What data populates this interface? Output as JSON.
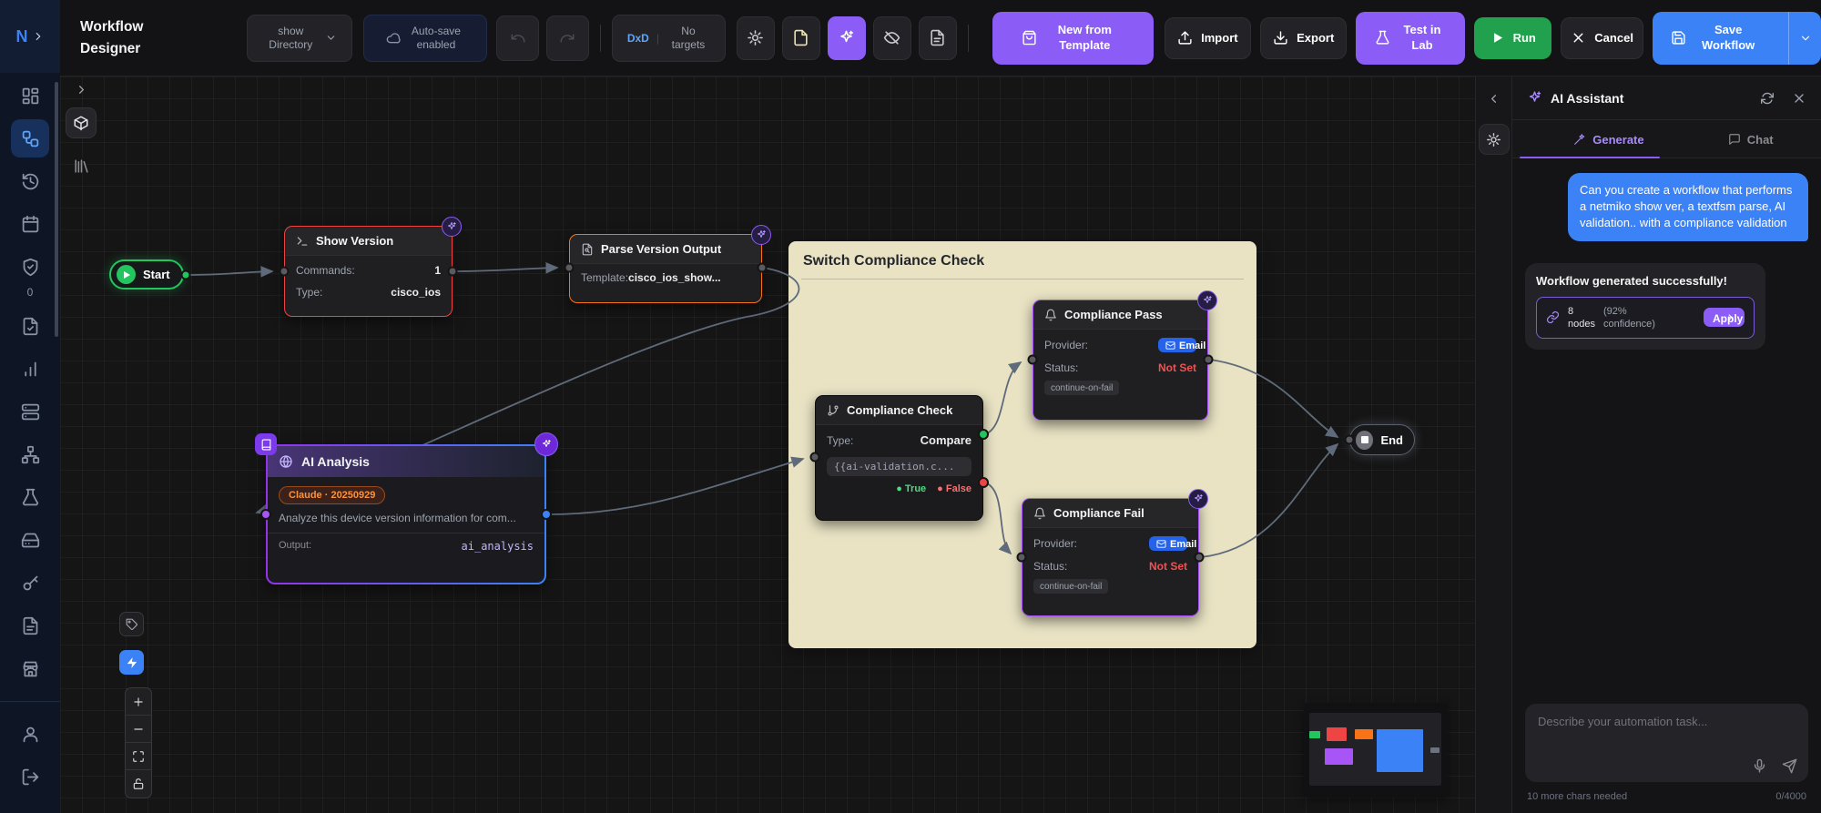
{
  "topbar": {
    "logo": "N",
    "title": "Workflow Designer",
    "directory_button": {
      "label": "show Directory"
    },
    "autosave": {
      "label": "Auto-save enabled"
    },
    "targets_button": {
      "prefix": "DxD",
      "label": "No targets"
    },
    "icon_buttons": [
      "settings-icon",
      "file-icon",
      "ai-sparkles-icon",
      "eye-off-icon",
      "notes-icon"
    ],
    "buttons": {
      "new_from_template": "New from Template",
      "import": "Import",
      "export": "Export",
      "test_in_lab": "Test in Lab",
      "run": "Run",
      "cancel": "Cancel",
      "save_workflow": "Save Workflow"
    }
  },
  "sidebar": {
    "badge_count": "0",
    "icons": [
      "dashboard",
      "workflow (active)",
      "history",
      "calendar",
      "shield-check",
      "file-check",
      "bar-chart",
      "server",
      "network",
      "flask",
      "hard-drive",
      "key",
      "file-text",
      "store",
      "user",
      "logout"
    ]
  },
  "canvas": {
    "nodes": {
      "start": {
        "label": "Start"
      },
      "show_version": {
        "title": "Show Version",
        "rows": [
          {
            "label": "Commands:",
            "value": "1"
          },
          {
            "label": "Type:",
            "value": "cisco_ios"
          }
        ]
      },
      "parse_version": {
        "title": "Parse Version Output",
        "label": "Template:",
        "value": "cisco_ios_show..."
      },
      "ai_analysis": {
        "title": "AI Analysis",
        "model_badge": "Claude · 20250929",
        "prompt": "Analyze this device version information for com...",
        "output_label": "Output:",
        "output_value": "ai_analysis"
      },
      "group": {
        "title": "Switch Compliance Check"
      },
      "compliance_check": {
        "title": "Compliance Check",
        "type_label": "Type:",
        "type_value": "Compare",
        "expression": "{{ai-validation.c...",
        "true_label": "True",
        "false_label": "False"
      },
      "compliance_pass": {
        "title": "Compliance Pass",
        "provider_label": "Provider:",
        "provider_value": "Email",
        "status_label": "Status:",
        "status_value": "Not Set",
        "tag": "continue-on-fail"
      },
      "compliance_fail": {
        "title": "Compliance Fail",
        "provider_label": "Provider:",
        "provider_value": "Email",
        "status_label": "Status:",
        "status_value": "Not Set",
        "tag": "continue-on-fail"
      },
      "end": {
        "label": "End"
      }
    },
    "edges": [
      [
        "start",
        "show_version"
      ],
      [
        "show_version",
        "parse_version"
      ],
      [
        "parse_version",
        "ai_analysis"
      ],
      [
        "ai_analysis",
        "compliance_check"
      ],
      [
        "compliance_check:true",
        "compliance_pass"
      ],
      [
        "compliance_check:false",
        "compliance_fail"
      ],
      [
        "compliance_pass",
        "end"
      ],
      [
        "compliance_fail",
        "end"
      ]
    ]
  },
  "assistant": {
    "title": "AI Assistant",
    "tabs": {
      "generate": "Generate",
      "chat": "Chat"
    },
    "user_message": "Can you create a workflow that performs a netmiko show ver, a textfsm parse, AI validation.. with a compliance validation",
    "result": {
      "message": "Workflow generated successfully!",
      "nodes_count": "8",
      "nodes_word": "nodes",
      "confidence_open": "(92%",
      "confidence_close": "confidence)",
      "apply": "Apply"
    },
    "input": {
      "placeholder": "Describe your automation task...",
      "hint": "10 more chars needed",
      "counter": "0/4000"
    }
  },
  "colors": {
    "accent_purple": "#8b5cf6",
    "accent_blue": "#3b82f6",
    "run_green": "#21a14d",
    "start_green": "#22c55e",
    "error_red": "#ef4444",
    "warn_orange": "#f97316",
    "group_beige": "#e9e3c4",
    "email_blue": "#2563eb",
    "claude_orange": "#fb923c"
  }
}
